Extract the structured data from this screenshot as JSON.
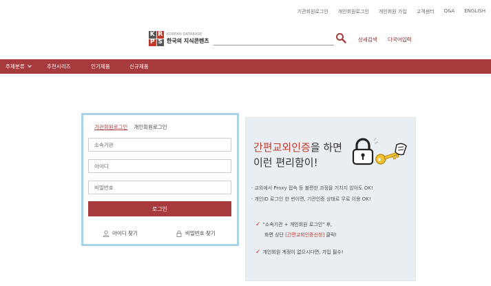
{
  "util_links": [
    "기관회원로그인",
    "개인회원로그인",
    "개인회원 가입",
    "고객센터",
    "Q&A",
    "ENGLISH"
  ],
  "logo": {
    "letters": [
      "K",
      "R",
      "P",
      "S"
    ],
    "en": "KOREAN DATABASE",
    "ko": "한국의 지식콘텐츠"
  },
  "search": {
    "icon": "search-icon",
    "advanced": "상세검색",
    "multi": "다국어입력"
  },
  "nav": {
    "items": [
      "주제분류",
      "추천시리즈",
      "인기제품",
      "신규제품"
    ],
    "dropdown_icon": "chevron-down-icon"
  },
  "login": {
    "tab_institution": "기관회원로그인",
    "tab_personal": "개인회원로그인",
    "field_org_placeholder": "소속기관",
    "field_id_placeholder": "아이디",
    "field_pw_placeholder": "비밀번호",
    "button": "로그인",
    "find_id": "아이디 찾기",
    "find_pw": "비밀번호 찾기",
    "find_id_icon": "person-icon",
    "find_pw_icon": "lock-icon"
  },
  "promo": {
    "title_highlight": "간편교외인증",
    "title_rest": "을 하면",
    "title_line2": "이런 편리함이!",
    "bullet1": "· 교외에서 Proxy 접속 등 불편한 과정을 거치지 않아도 OK!",
    "bullet2": "· 개인ID 로그인 한 번이면, 기관인증 상태로 무료 이용 OK!",
    "check1_line1": "\"소속기관 + 개인회원 로그인\" 후,",
    "check1_line2_pre": "화면 상단 ",
    "check1_line2_hl": "[간편교외인증신청]",
    "check1_line2_post": " 클릭!",
    "check2": "개인회원 계정이 없으시다면, 가입 필수!",
    "check_icon": "checkmark-icon",
    "illustration": "padlock-and-key-icon"
  },
  "colors": {
    "brand": "#a63a3c",
    "border_accent": "#a9d4e8",
    "promo_bg": "#e9eef3",
    "highlight": "#c0392b"
  }
}
